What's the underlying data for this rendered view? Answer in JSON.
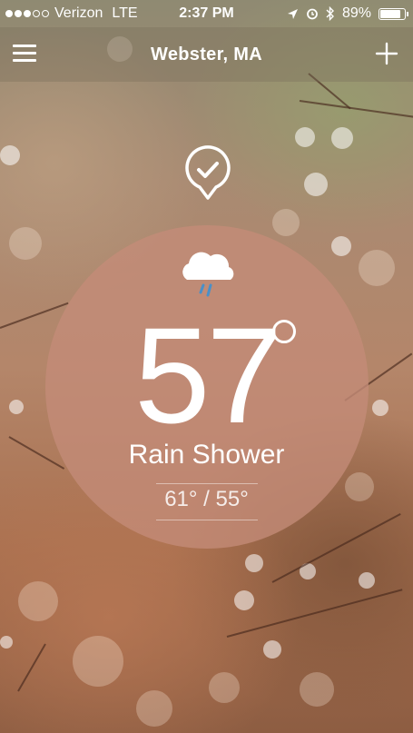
{
  "status_bar": {
    "carrier": "Verizon",
    "network": "LTE",
    "time": "2:37 PM",
    "battery": "89%",
    "signal_bars": 3,
    "signal_total": 5,
    "icons": [
      "location-arrow-icon",
      "alarm-clock-icon",
      "bluetooth-icon",
      "battery-icon"
    ]
  },
  "header": {
    "city": "Webster, MA",
    "menu_icon": "hamburger-menu-icon",
    "add_icon": "plus-icon"
  },
  "location_marker": {
    "icon": "checkmark-pin-icon"
  },
  "weather": {
    "icon": "rain-cloud-icon",
    "temperature": "57",
    "condition": "Rain Shower",
    "hi_lo": "61° / 55°"
  },
  "colors": {
    "circle": "#c48c78",
    "text": "#ffffff",
    "rain_drop": "#4a90c8"
  }
}
